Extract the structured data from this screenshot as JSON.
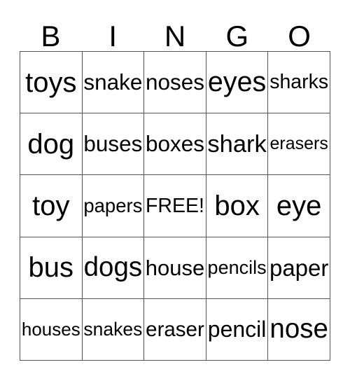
{
  "card": {
    "title": "BINGO",
    "header_letters": [
      "B",
      "I",
      "N",
      "G",
      "O"
    ],
    "columns": 5,
    "rows": 5,
    "free_space": {
      "label": "FREE!",
      "row": 2,
      "column": 2
    },
    "colors": {
      "grid_line": "#555555",
      "text": "#000000",
      "background": "#ffffff"
    },
    "grid": [
      [
        {
          "text": "toys"
        },
        {
          "text": "snake"
        },
        {
          "text": "noses"
        },
        {
          "text": "eyes"
        },
        {
          "text": "sharks"
        }
      ],
      [
        {
          "text": "dog"
        },
        {
          "text": "buses"
        },
        {
          "text": "boxes"
        },
        {
          "text": "shark"
        },
        {
          "text": "erasers"
        }
      ],
      [
        {
          "text": "toy"
        },
        {
          "text": "papers"
        },
        {
          "text": "FREE!"
        },
        {
          "text": "box"
        },
        {
          "text": "eye"
        }
      ],
      [
        {
          "text": "bus"
        },
        {
          "text": "dogs"
        },
        {
          "text": "house"
        },
        {
          "text": "pencils"
        },
        {
          "text": "paper"
        }
      ],
      [
        {
          "text": "houses"
        },
        {
          "text": "snakes"
        },
        {
          "text": "eraser"
        },
        {
          "text": "pencil"
        },
        {
          "text": "nose"
        }
      ]
    ]
  }
}
